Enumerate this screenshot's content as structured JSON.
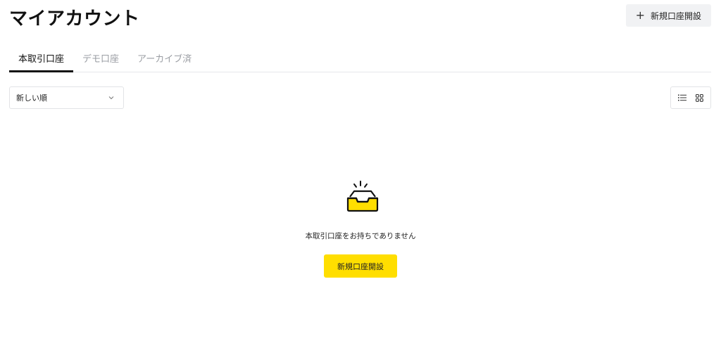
{
  "header": {
    "title": "マイアカウント",
    "open_account_label": "新規口座開設"
  },
  "tabs": [
    {
      "label": "本取引口座",
      "active": true
    },
    {
      "label": "デモ口座",
      "active": false
    },
    {
      "label": "アーカイブ済",
      "active": false
    }
  ],
  "sort": {
    "selected": "新しい順"
  },
  "view": {
    "mode": "list"
  },
  "empty_state": {
    "message": "本取引口座をお持ちでありません",
    "button_label": "新規口座開設"
  },
  "colors": {
    "accent": "#ffde00",
    "text": "#111111",
    "muted": "#9a9da3"
  }
}
